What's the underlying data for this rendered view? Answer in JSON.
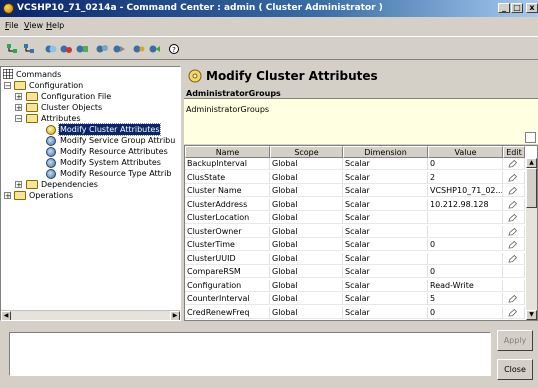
{
  "window": {
    "title": "VCSHP10_71_0214a - Command Center : admin ( Cluster Administrator )",
    "controls": [
      "_",
      "□",
      "x"
    ]
  },
  "menu": [
    "File",
    "View",
    "Help"
  ],
  "toolbar": {
    "icons": [
      "tree-toggle-icon",
      "tree-expand-icon",
      "connect-icon",
      "group-icon",
      "resource-icon",
      "system-icon",
      "type-icon",
      "config-icon",
      "help-icon"
    ]
  },
  "tree": {
    "items": [
      {
        "label": "Commands",
        "level": 0
      },
      {
        "label": "Configuration",
        "level": 1
      },
      {
        "label": "Configuration File",
        "level": 2
      },
      {
        "label": "Cluster Objects",
        "level": 2
      },
      {
        "label": "Attributes",
        "level": 2
      },
      {
        "label": "Modify Cluster Attributes",
        "level": 3,
        "selected": true
      },
      {
        "label": "Modify Service Group Attribu",
        "level": 3
      },
      {
        "label": "Modify Resource Attributes",
        "level": 3
      },
      {
        "label": "Modify System Attributes",
        "level": 3
      },
      {
        "label": "Modify Resource Type Attrib",
        "level": 3
      },
      {
        "label": "Dependencies",
        "level": 2
      },
      {
        "label": "Operations",
        "level": 1
      }
    ]
  },
  "panel": {
    "title": "Modify Cluster Attributes",
    "group_header": "AdministratorGroups",
    "group_value": "AdministratorGroups"
  },
  "table": {
    "columns": [
      "Name",
      "Scope",
      "Dimension",
      "Value",
      "Edit"
    ],
    "rows": [
      [
        "BackupInterval",
        "Global",
        "Scalar",
        "0",
        "edit"
      ],
      [
        "ClusState",
        "Global",
        "Scalar",
        "2",
        "edit"
      ],
      [
        "Cluster Name",
        "Global",
        "Scalar",
        "VCSHP10_71_02...",
        "edit"
      ],
      [
        "ClusterAddress",
        "Global",
        "Scalar",
        "10.212.98.128",
        "edit"
      ],
      [
        "ClusterLocation",
        "Global",
        "Scalar",
        "",
        "edit"
      ],
      [
        "ClusterOwner",
        "Global",
        "Scalar",
        "",
        "edit"
      ],
      [
        "ClusterTime",
        "Global",
        "Scalar",
        "0",
        "edit"
      ],
      [
        "ClusterUUID",
        "Global",
        "Scalar",
        "",
        "edit"
      ],
      [
        "CompareRSM",
        "Global",
        "Scalar",
        "0",
        ""
      ],
      [
        "Configuration",
        "Global",
        "Scalar",
        "Read-Write",
        ""
      ],
      [
        "CounterInterval",
        "Global",
        "Scalar",
        "5",
        "edit"
      ],
      [
        "CredRenewFreq",
        "Global",
        "Scalar",
        "0",
        "edit"
      ]
    ]
  },
  "buttons": {
    "apply": "Apply",
    "close": "Close"
  }
}
